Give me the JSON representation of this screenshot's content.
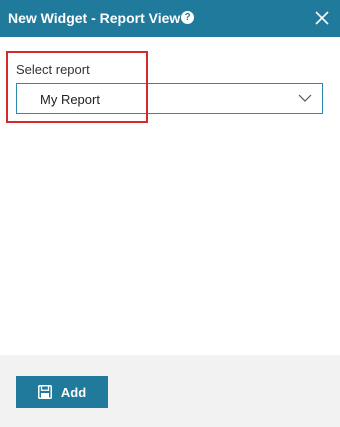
{
  "dialog": {
    "title": "New Widget - Report View",
    "help_icon": "help-icon",
    "close_icon": "close-icon",
    "header_color": "#1f7a9c"
  },
  "form": {
    "select_label": "Select report",
    "select_value": "My Report",
    "select_icon": "chevron-down-icon",
    "highlight_color": "#d42a2a"
  },
  "footer": {
    "add_label": "Add",
    "add_icon": "save-icon"
  }
}
